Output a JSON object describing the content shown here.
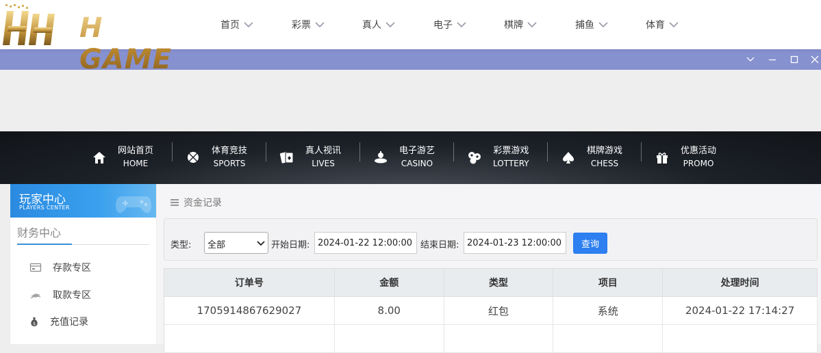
{
  "brand": {
    "logo_text": "H GAME"
  },
  "topnav": [
    {
      "label": "首页"
    },
    {
      "label": "彩票"
    },
    {
      "label": "真人"
    },
    {
      "label": "电子"
    },
    {
      "label": "棋牌"
    },
    {
      "label": "捕鱼"
    },
    {
      "label": "体育"
    }
  ],
  "window_controls": [
    "chevron-down-icon",
    "minimize-icon",
    "maximize-icon",
    "close-icon"
  ],
  "gamenav": [
    {
      "cn": "网站首页",
      "en": "HOME",
      "icon": "home-icon"
    },
    {
      "cn": "体育竞技",
      "en": "SPORTS",
      "icon": "ball-icon"
    },
    {
      "cn": "真人视讯",
      "en": "LIVES",
      "icon": "cards-icon"
    },
    {
      "cn": "电子游艺",
      "en": "CASINO",
      "icon": "slot-icon"
    },
    {
      "cn": "彩票游戏",
      "en": "LOTTERY",
      "icon": "lottery-balls-icon"
    },
    {
      "cn": "棋牌游戏",
      "en": "CHESS",
      "icon": "spade-icon"
    },
    {
      "cn": "优惠活动",
      "en": "PROMO",
      "icon": "gift-icon"
    }
  ],
  "sidebar": {
    "title": "玩家中心",
    "subtitle": "PLAYERS CENTER",
    "section": "财务中心",
    "items": [
      {
        "label": "存款专区",
        "icon": "deposit-icon"
      },
      {
        "label": "取款专区",
        "icon": "withdraw-icon"
      },
      {
        "label": "充值记录",
        "icon": "money-bag-icon"
      }
    ]
  },
  "breadcrumb": {
    "icon": "menu-icon",
    "label": "资金记录"
  },
  "filter": {
    "type_label": "类型:",
    "type_value": "全部",
    "start_label": "开始日期:",
    "start_value": "2024-01-22 12:00:00",
    "end_label": "结束日期:",
    "end_value": "2024-01-23 12:00:00",
    "query_label": "查询"
  },
  "table": {
    "headers": [
      "订单号",
      "金额",
      "类型",
      "项目",
      "处理时间"
    ],
    "rows": [
      [
        "1705914867629027",
        "8.00",
        "红包",
        "系统",
        "2024-01-22 17:14:27"
      ]
    ]
  },
  "colors": {
    "accent": "#2e7ff0",
    "winbar": "#8691d0",
    "sidebar_head": "#3aa0ee"
  }
}
